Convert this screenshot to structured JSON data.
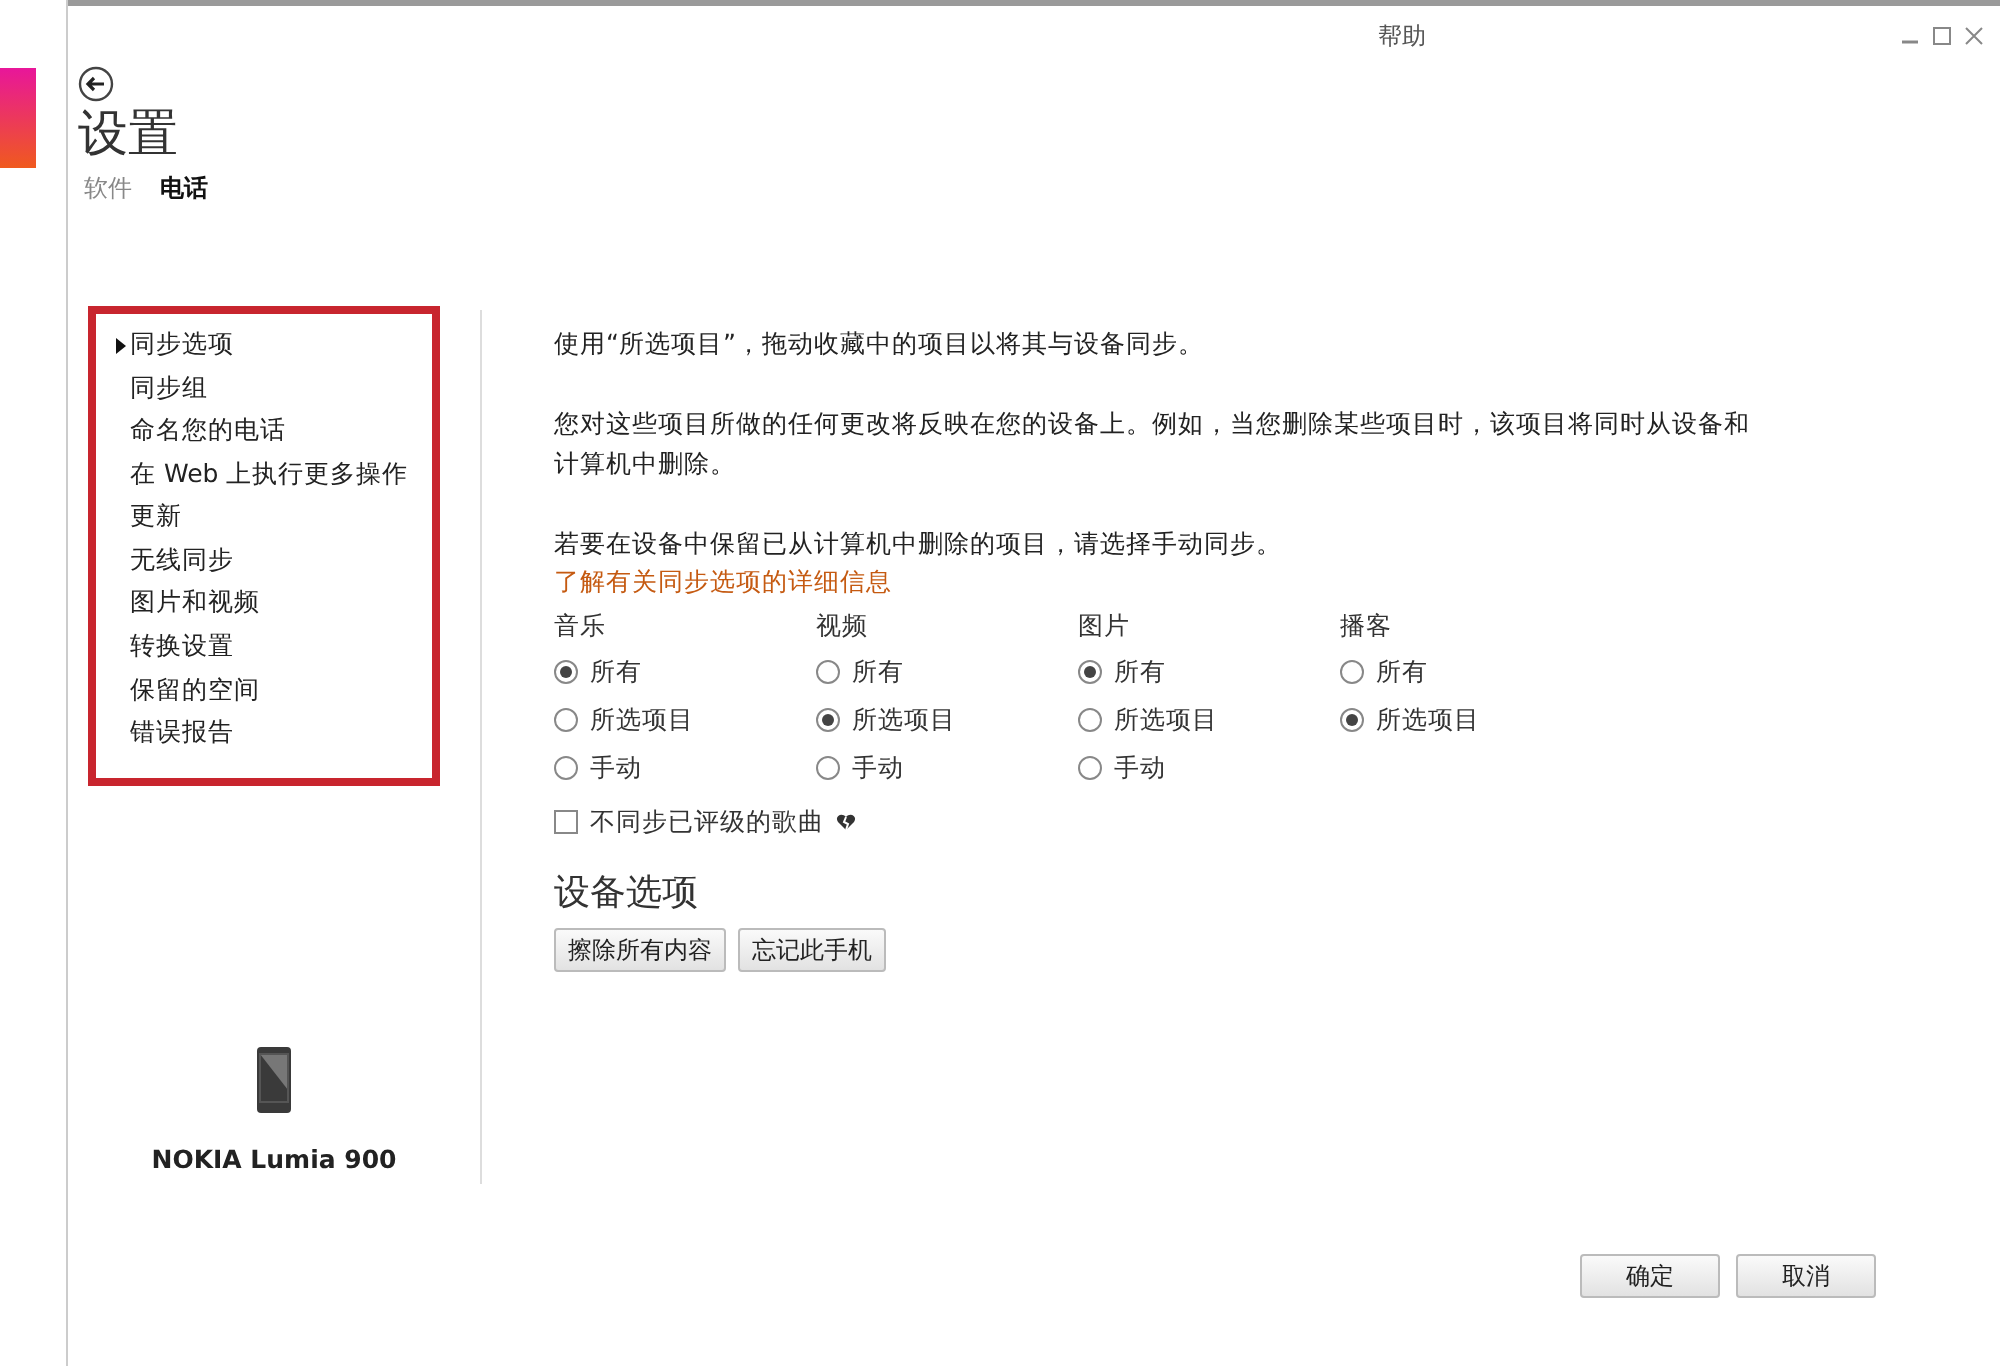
{
  "window": {
    "help_link": "帮助"
  },
  "header": {
    "title": "设置",
    "tabs": [
      {
        "label": "软件",
        "selected": false
      },
      {
        "label": "电话",
        "selected": true
      }
    ]
  },
  "sidebar": {
    "items": [
      {
        "label": "同步选项",
        "selected": true
      },
      {
        "label": "同步组",
        "selected": false
      },
      {
        "label": "命名您的电话",
        "selected": false
      },
      {
        "label": "在 Web 上执行更多操作",
        "selected": false
      },
      {
        "label": "更新",
        "selected": false
      },
      {
        "label": "无线同步",
        "selected": false
      },
      {
        "label": "图片和视频",
        "selected": false
      },
      {
        "label": "转换设置",
        "selected": false
      },
      {
        "label": "保留的空间",
        "selected": false
      },
      {
        "label": "错误报告",
        "selected": false
      }
    ],
    "device_name": "NOKIA Lumia 900"
  },
  "content": {
    "paragraphs": [
      "使用“所选项目”，拖动收藏中的项目以将其与设备同步。",
      "您对这些项目所做的任何更改将反映在您的设备上。例如，当您删除某些项目时，该项目将同时从设备和计算机中删除。",
      "若要在设备中保留已从计算机中删除的项目，请选择手动同步。"
    ],
    "link": "了解有关同步选项的详细信息",
    "sync_groups": [
      {
        "label": "音乐",
        "options": [
          {
            "label": "所有",
            "selected": true
          },
          {
            "label": "所选项目",
            "selected": false
          },
          {
            "label": "手动",
            "selected": false
          }
        ]
      },
      {
        "label": "视频",
        "options": [
          {
            "label": "所有",
            "selected": false
          },
          {
            "label": "所选项目",
            "selected": true
          },
          {
            "label": "手动",
            "selected": false
          }
        ]
      },
      {
        "label": "图片",
        "options": [
          {
            "label": "所有",
            "selected": true
          },
          {
            "label": "所选项目",
            "selected": false
          },
          {
            "label": "手动",
            "selected": false
          }
        ]
      },
      {
        "label": "播客",
        "options": [
          {
            "label": "所有",
            "selected": false
          },
          {
            "label": "所选项目",
            "selected": true
          }
        ]
      }
    ],
    "checkbox": {
      "label": "不同步已评级的歌曲",
      "checked": false
    },
    "section_title": "设备选项",
    "device_buttons": [
      "擦除所有内容",
      "忘记此手机"
    ]
  },
  "footer_buttons": [
    "确定",
    "取消"
  ]
}
